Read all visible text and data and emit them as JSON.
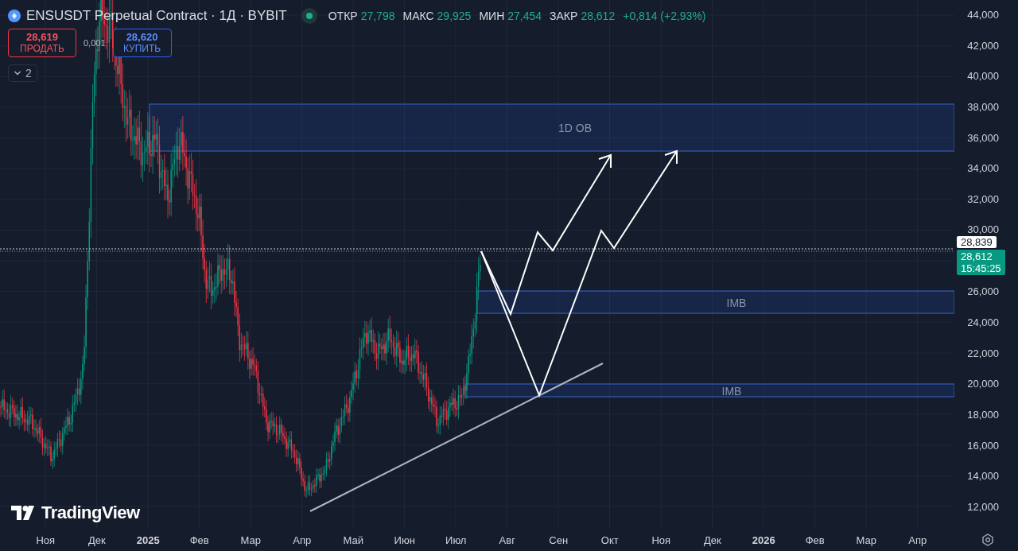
{
  "header": {
    "symbol_title": "ENSUSDT Perpetual Contract · 1Д · BYBIT",
    "market_open": true,
    "ohlc": [
      {
        "label": "ОТКР",
        "value": "27,798"
      },
      {
        "label": "МАКС",
        "value": "29,925"
      },
      {
        "label": "МИН",
        "value": "27,454"
      },
      {
        "label": "ЗАКР",
        "value": "28,612"
      }
    ],
    "change": "+0,814 (+2,93%)"
  },
  "trade": {
    "sell": {
      "price": "28,619",
      "label": "ПРОДАТЬ"
    },
    "spread": "0,001",
    "buy": {
      "price": "28,620",
      "label": "КУПИТЬ"
    }
  },
  "indicators_toggle": {
    "count": "2"
  },
  "zones": [
    {
      "label": "1D OB"
    },
    {
      "label": "IMB"
    },
    {
      "label": "IMB"
    }
  ],
  "price_axis": {
    "ticks": [
      "44,000",
      "42,000",
      "40,000",
      "38,000",
      "36,000",
      "34,000",
      "32,000",
      "30,000",
      "26,000",
      "24,000",
      "22,000",
      "20,000",
      "18,000",
      "16,000",
      "14,000",
      "12,000"
    ],
    "crosshair_label": "28,839",
    "last_price": "28,612",
    "countdown": "15:45:25"
  },
  "time_axis": [
    {
      "label": "Ноя",
      "kind": "month"
    },
    {
      "label": "Дек",
      "kind": "month"
    },
    {
      "label": "2025",
      "kind": "year"
    },
    {
      "label": "Фев",
      "kind": "month"
    },
    {
      "label": "Мар",
      "kind": "month"
    },
    {
      "label": "Апр",
      "kind": "month"
    },
    {
      "label": "Май",
      "kind": "month"
    },
    {
      "label": "Июн",
      "kind": "month"
    },
    {
      "label": "Июл",
      "kind": "month"
    },
    {
      "label": "Авг",
      "kind": "month"
    },
    {
      "label": "Сен",
      "kind": "month"
    },
    {
      "label": "Окт",
      "kind": "month"
    },
    {
      "label": "Ноя",
      "kind": "month"
    },
    {
      "label": "Дек",
      "kind": "month"
    },
    {
      "label": "2026",
      "kind": "year"
    },
    {
      "label": "Фев",
      "kind": "month"
    },
    {
      "label": "Мар",
      "kind": "month"
    },
    {
      "label": "Апр",
      "kind": "month"
    }
  ],
  "logo": "TradingView"
}
